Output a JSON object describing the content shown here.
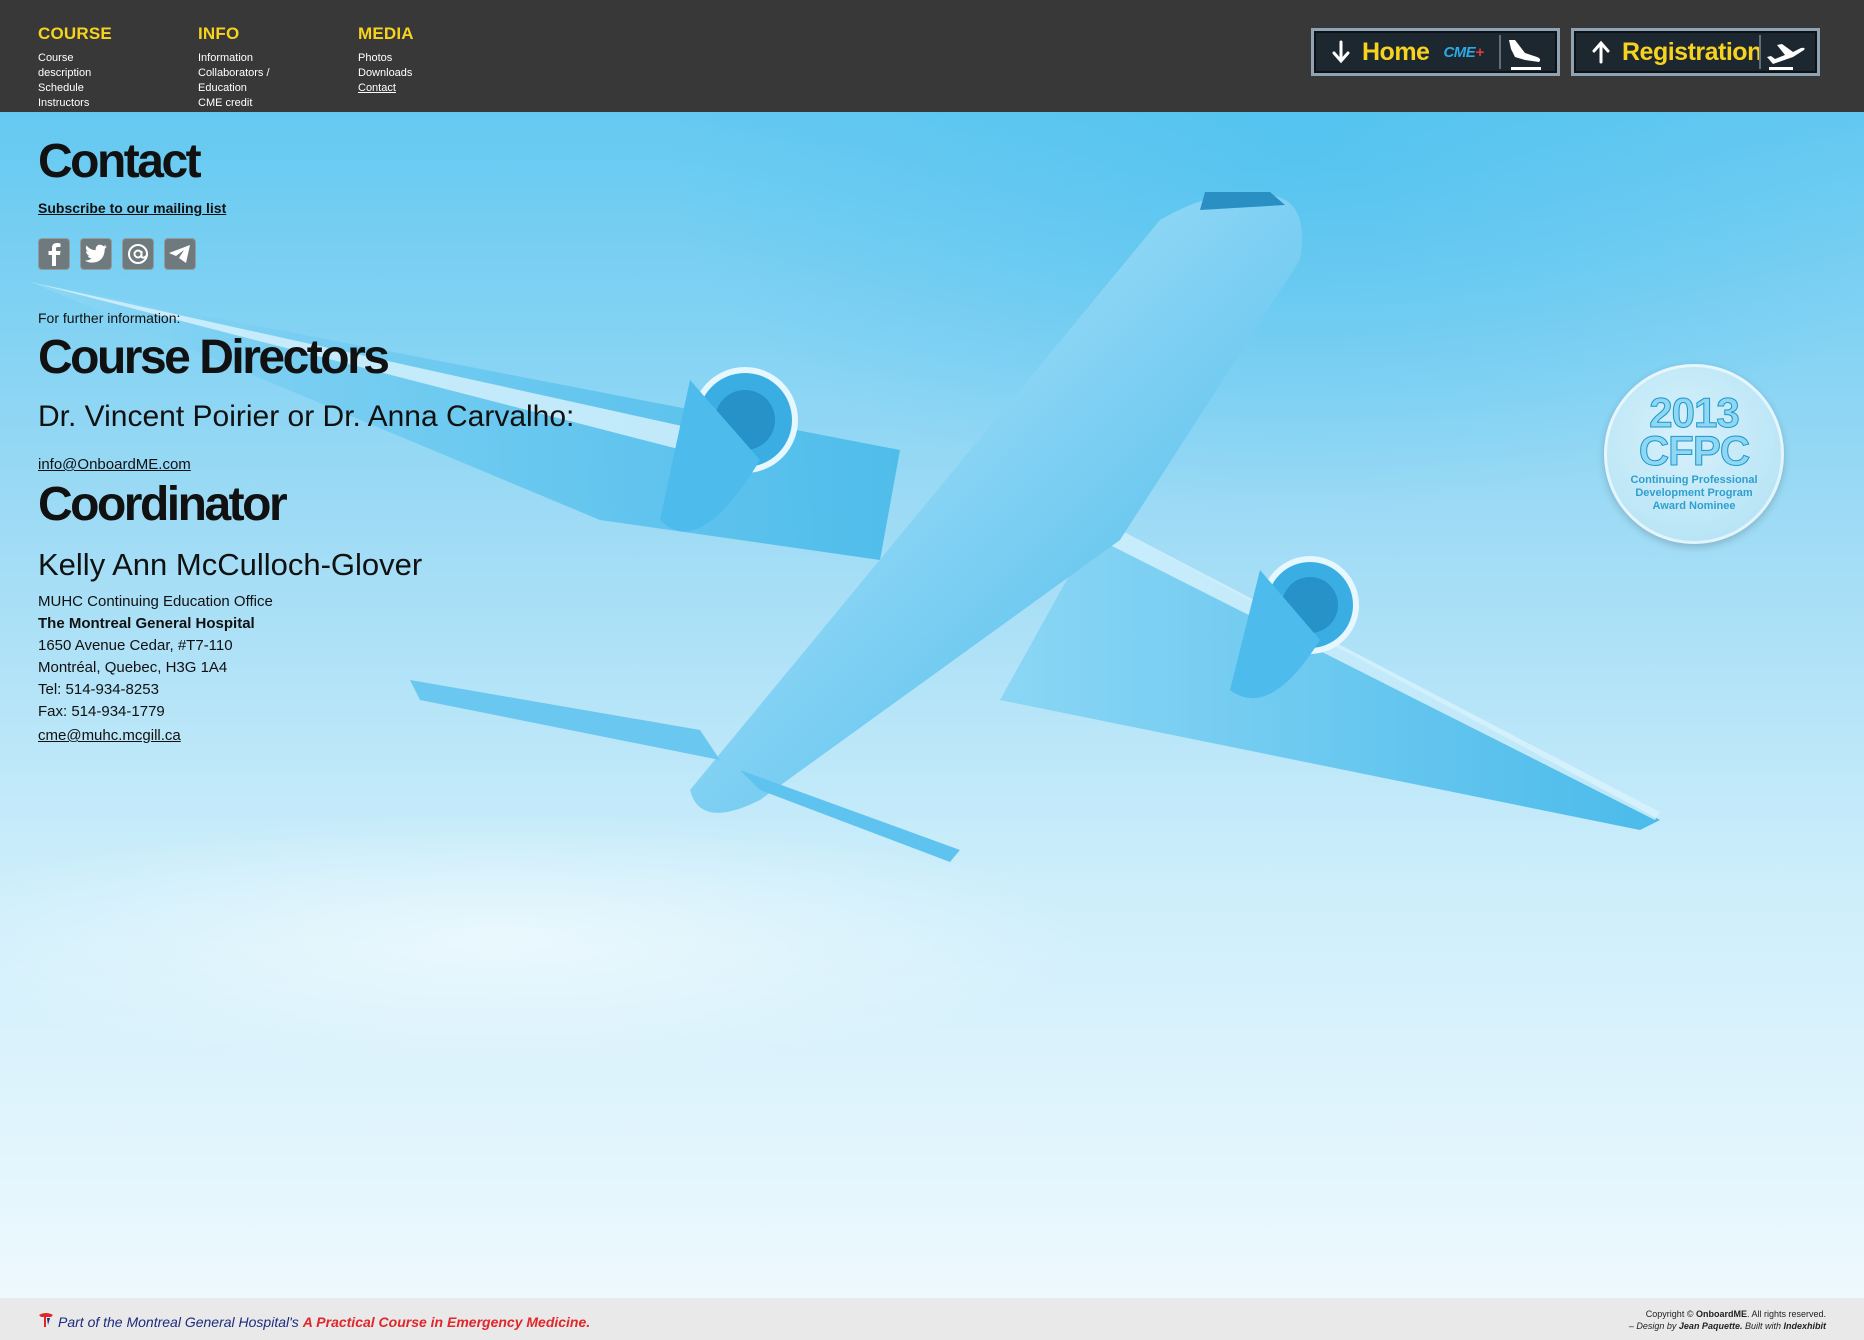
{
  "nav": {
    "course": {
      "heading": "COURSE",
      "items": [
        "Course description",
        "Schedule",
        "Instructors"
      ]
    },
    "info": {
      "heading": "INFO",
      "items": [
        "Information",
        "Collaborators / Education",
        "CME credit"
      ]
    },
    "media": {
      "heading": "MEDIA",
      "items": [
        "Photos",
        "Downloads",
        "Contact"
      ]
    }
  },
  "buttons": {
    "home_label": "Home",
    "home_logo": "CME",
    "home_logo_plus": "+",
    "registration_label": "Registration"
  },
  "page": {
    "title": "Contact",
    "subscribe_link": "Subscribe to our mailing list",
    "social_icons": [
      "facebook-icon",
      "twitter-icon",
      "email-icon",
      "telegram-icon"
    ],
    "further_info": "For further information:",
    "directors_heading": "Course Directors",
    "directors_names": "Dr. Vincent Poirier or Dr. Anna Carvalho:",
    "directors_email": "info@OnboardME.com",
    "coordinator_heading": "Coordinator",
    "coordinator_name": "Kelly Ann McCulloch-Glover",
    "address": {
      "office": "MUHC Continuing Education Office",
      "hospital": "The Montreal General Hospital",
      "street": "1650 Avenue Cedar, #T7-110",
      "city": "Montréal, Quebec, H3G 1A4",
      "tel": "Tel: 514-934-8253",
      "fax": "Fax: 514-934-1779"
    },
    "coordinator_email": "cme@muhc.mcgill.ca"
  },
  "badge": {
    "year": "2013",
    "org": "CFPC",
    "line1": "Continuing Professional",
    "line2": "Development Program",
    "line3": "Award Nominee"
  },
  "footer": {
    "left_part1": "Part of the Montreal General Hospital's",
    "left_part2": "A Practical Course in Emergency Medicine.",
    "copyright_prefix": "Copyright ©",
    "copyright_brand": "OnboardME",
    "copyright_suffix": ". All rights reserved.",
    "design_prefix": "– Design by",
    "designer": "Jean Paquette.",
    "built_with": "Built with",
    "platform": "Indexhibit"
  },
  "colors": {
    "topbar": "#383838",
    "nav_heading": "#f7d21e",
    "button_text": "#f7d21e",
    "sky": "#64c9f1",
    "footer_bg": "#e9e9e9",
    "footer_red": "#e0262a",
    "footer_blue": "#1d2b7d"
  }
}
